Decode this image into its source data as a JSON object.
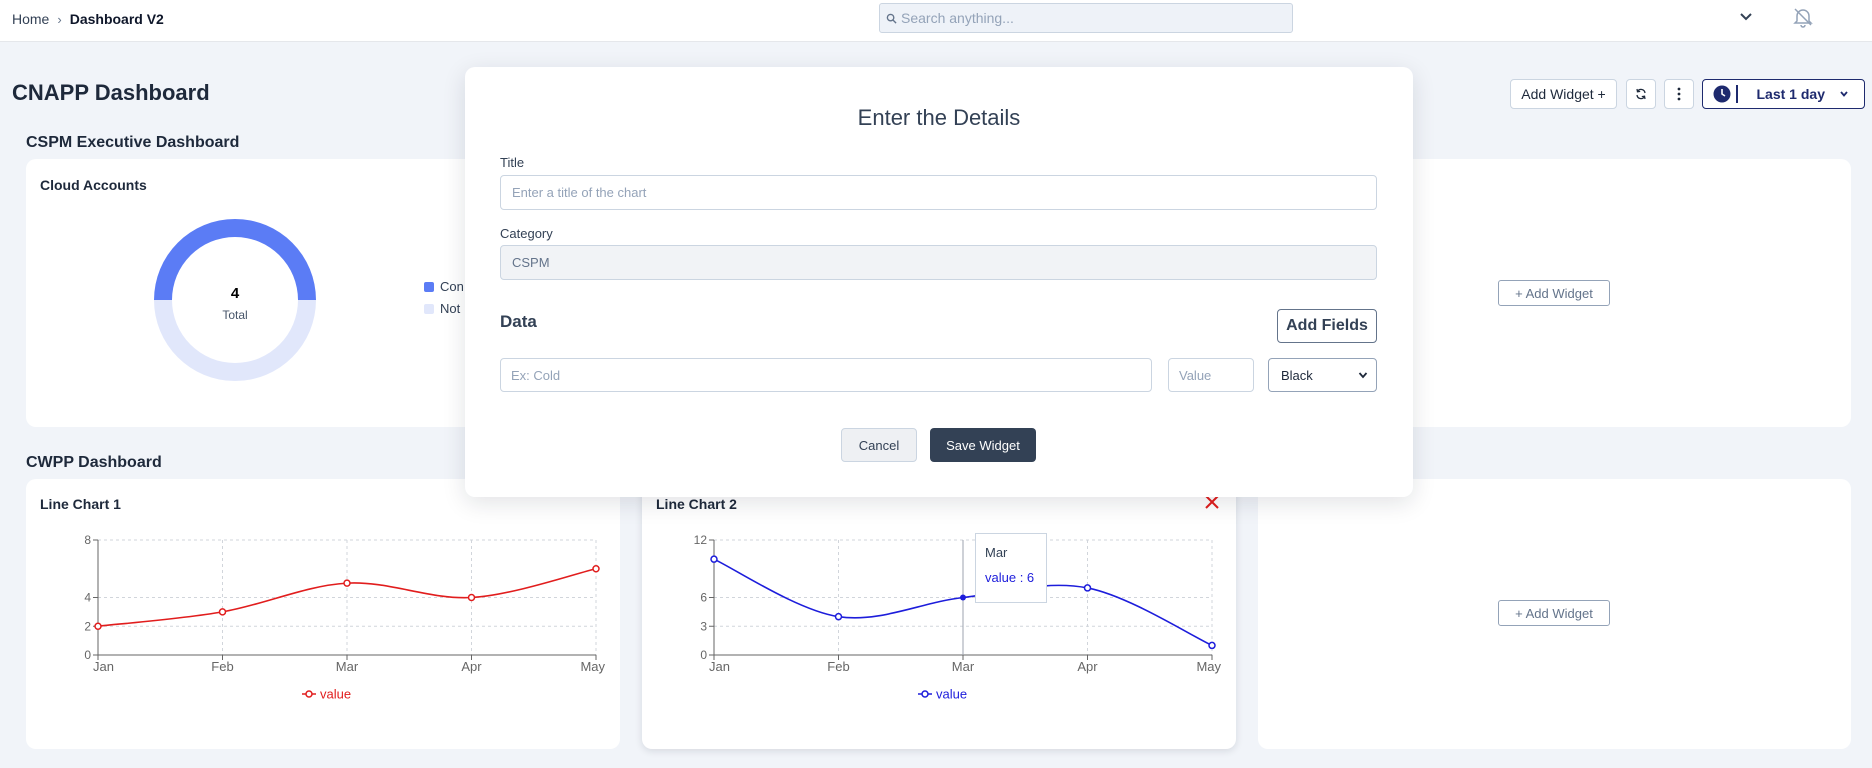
{
  "breadcrumb": {
    "home": "Home",
    "current": "Dashboard V2"
  },
  "search": {
    "placeholder": "Search anything..."
  },
  "page_title": "CNAPP Dashboard",
  "toolbar": {
    "add_widget": "Add Widget +",
    "range": "Last 1 day"
  },
  "sections": {
    "cspm": {
      "title": "CSPM Executive Dashboard"
    },
    "cwpp": {
      "title": "CWPP Dashboard"
    }
  },
  "cloud_accounts": {
    "title": "Cloud Accounts",
    "total_value": "4",
    "total_label": "Total",
    "legend": [
      "Con",
      "Not"
    ],
    "colors": [
      "#5b7cf5",
      "#e1e7fb"
    ]
  },
  "add_widget_label": "+ Add Widget",
  "modal": {
    "heading": "Enter the Details",
    "title_label": "Title",
    "title_placeholder": "Enter a title of the chart",
    "category_label": "Category",
    "category_value": "CSPM",
    "data_heading": "Data",
    "add_fields": "Add Fields",
    "data_placeholder": "Ex: Cold",
    "value_placeholder": "Value",
    "color_selected": "Black",
    "cancel": "Cancel",
    "save": "Save Widget"
  },
  "chart_data": [
    {
      "type": "line",
      "title": "Line Chart 1",
      "categories": [
        "Jan",
        "Feb",
        "Mar",
        "Apr",
        "May"
      ],
      "series": [
        {
          "name": "value",
          "values": [
            2,
            3,
            5,
            4,
            6
          ],
          "color": "#e11d1d"
        }
      ],
      "yticks": [
        0,
        2,
        4,
        8
      ],
      "ylim": [
        0,
        8
      ],
      "grid": true,
      "legend": "bottom"
    },
    {
      "type": "line",
      "title": "Line Chart 2",
      "categories": [
        "Jan",
        "Feb",
        "Mar",
        "Apr",
        "May"
      ],
      "series": [
        {
          "name": "value",
          "values": [
            10,
            4,
            6,
            7,
            1
          ],
          "color": "#1d1ddb"
        }
      ],
      "yticks": [
        0,
        3,
        6,
        12
      ],
      "ylim": [
        0,
        12
      ],
      "grid": true,
      "legend": "bottom",
      "tooltip": {
        "category": "Mar",
        "text": "value : 6"
      }
    }
  ]
}
